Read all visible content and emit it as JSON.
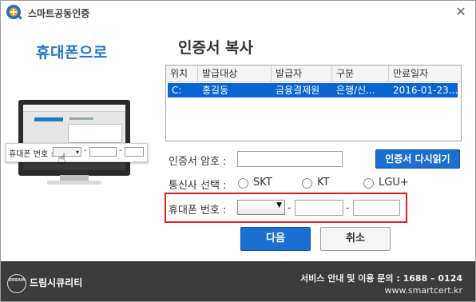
{
  "window": {
    "title": "스마트공동인증",
    "close_icon": "close-icon"
  },
  "left_panel": {
    "title": "휴대폰으로",
    "callout_label": "휴대폰 번호 :",
    "callout_dash": "-",
    "icons": [
      "monitor-illustration",
      "hand-cursor-icon"
    ]
  },
  "main": {
    "title": "인증서 복사",
    "table": {
      "columns": [
        "위치",
        "발급대상",
        "발급자",
        "구분",
        "만료일자"
      ],
      "rows": [
        {
          "location": "C:",
          "subject": "홍길동",
          "issuer": "금융결제원",
          "type": "은행/신...",
          "expiry": "2016-01-23..."
        }
      ]
    },
    "password": {
      "label": "인증서 암호 :",
      "value": "",
      "reread_button": "인증서 다시읽기"
    },
    "carrier": {
      "label": "통신사 선택 :",
      "options": [
        "SKT",
        "KT",
        "LGU+"
      ],
      "selected": null
    },
    "phone": {
      "label": "휴대폰 번호 :",
      "prefix_value": "",
      "dash": "-",
      "middle_value": "",
      "last_value": ""
    },
    "buttons": {
      "next": "다음",
      "cancel": "취소"
    }
  },
  "footer": {
    "logo_text": "DREAM",
    "company": "드림시큐리티",
    "support": "서비스 안내 및 이용 문의 : 1688 – 0124",
    "url": "www.smartcert.kr"
  },
  "colors": {
    "accent": "#1a6fd1",
    "selected_row": "#0a64d2",
    "highlight_border": "#e02020",
    "footer_bg": "#3c3c3c"
  }
}
